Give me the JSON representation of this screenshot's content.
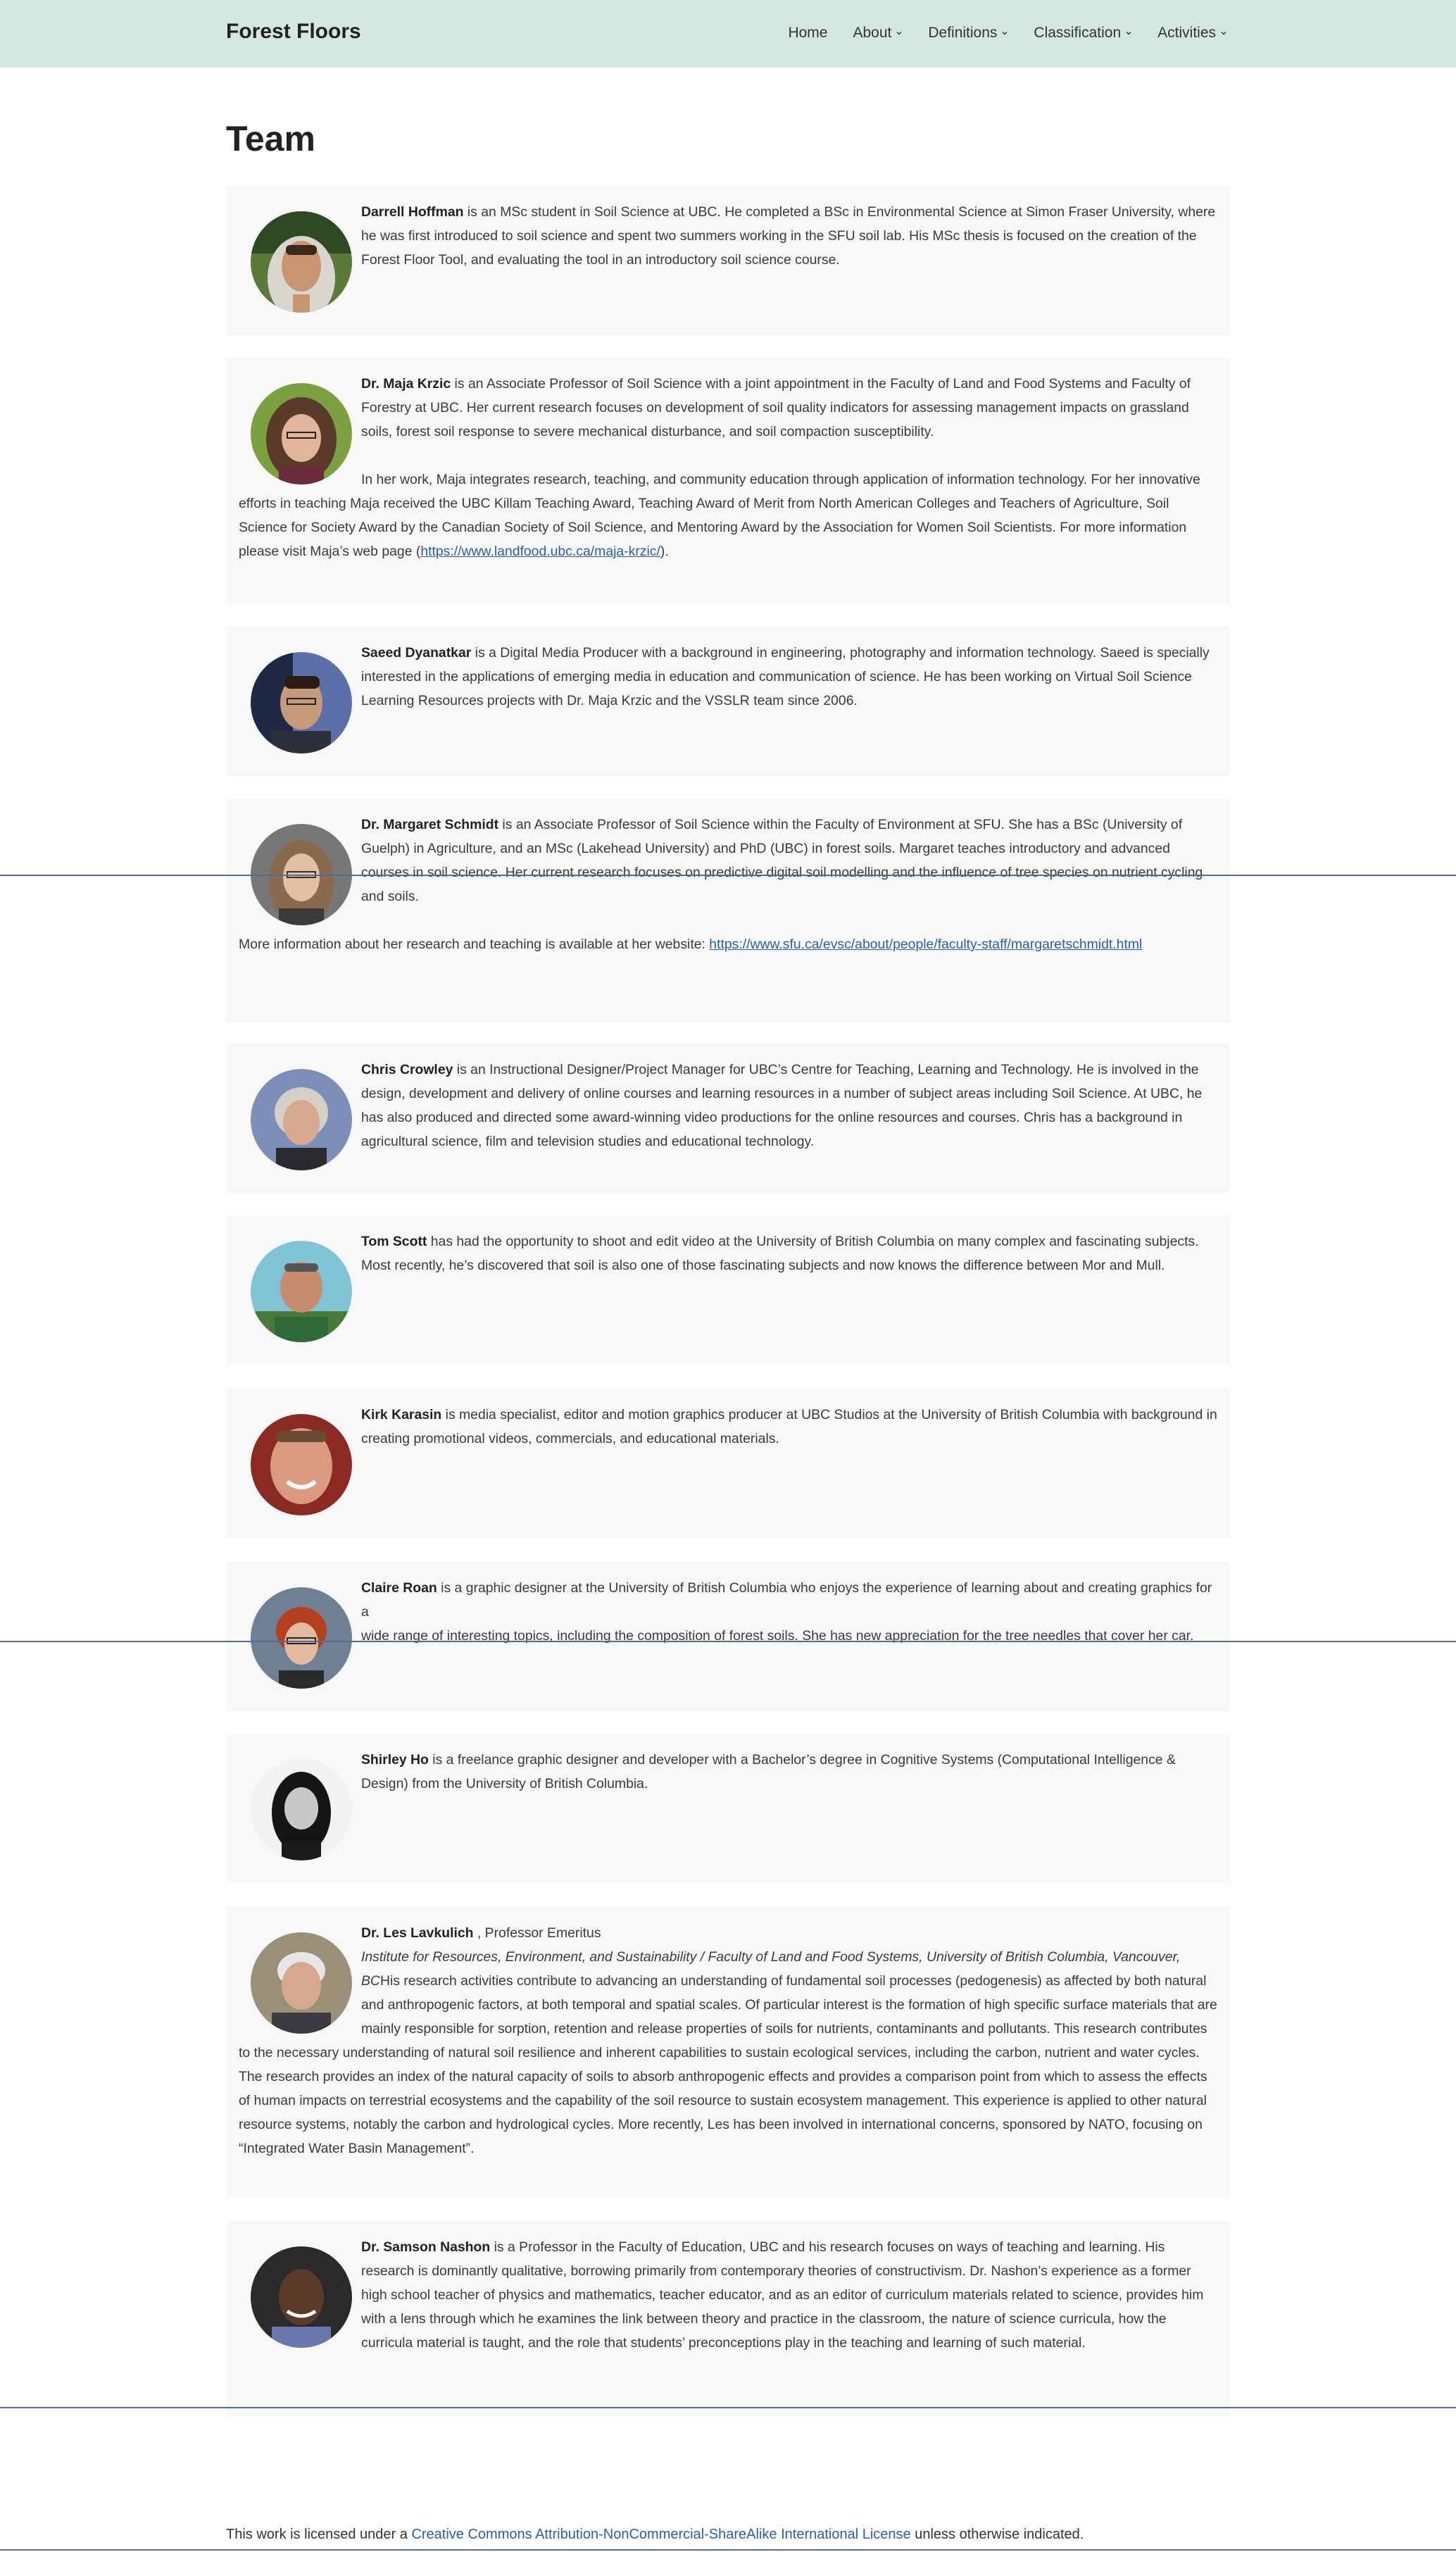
{
  "site": {
    "title": "Forest Floors"
  },
  "nav": [
    {
      "label": "Home",
      "dropdown": false
    },
    {
      "label": "About",
      "dropdown": true
    },
    {
      "label": "Definitions",
      "dropdown": true
    },
    {
      "label": "Classification",
      "dropdown": true
    },
    {
      "label": "Activities",
      "dropdown": true
    }
  ],
  "page": {
    "title": "Team"
  },
  "members": [
    {
      "name": "Darrell Hoffman",
      "bio": " is an MSc student in Soil Science at UBC. He completed a BSc in Environmental Science at Simon Fraser University, where he was first introduced to soil science and spent two summers working in the SFU soil lab. His MSc thesis is focused on the creation of the Forest Floor Tool, and evaluating the tool in an introductory soil science course.",
      "photo": "portrait-young-man-hoodie"
    },
    {
      "name": "Dr. Maja Krzic",
      "bio": " is an Associate Professor of Soil Science with a joint appointment in the Faculty of Land and Food Systems and Faculty of Forestry at UBC. Her current research focuses on development of soil quality indicators for assessing management impacts on grassland soils, forest soil response to severe mechanical disturbance, and soil compaction susceptibility.",
      "bio2": "In her work, Maja integrates research, teaching, and community education through application of information technology. For her innovative efforts in teaching Maja received the UBC Killam Teaching Award, Teaching Award of Merit from North American Colleges and Teachers of Agriculture, Soil Science for Society Award by the Canadian Society of Soil Science, and Mentoring Award by the Association for Women Soil Scientists. For more information please visit Maja’s web page (",
      "link": "https://www.landfood.ubc.ca/maja-krzic/",
      "bio2_end": ").",
      "photo": "portrait-woman-glasses"
    },
    {
      "name": "Saeed Dyanatkar",
      "bio": " is a Digital Media Producer with a background in engineering, photography and information technology. Saeed is specially interested in the applications of emerging media in education and communication of science. He has been working on Virtual Soil Science Learning Resources projects with Dr. Maja Krzic and the VSSLR team since 2006.",
      "photo": "portrait-man-glasses"
    },
    {
      "name": "Dr. Margaret Schmidt",
      "bio": " is an Associate Professor of Soil Science within the Faculty of Environment at SFU. She has a BSc (University of Guelph) in Agriculture, and an MSc (Lakehead University) and PhD (UBC) in forest soils. Margaret teaches introductory and advanced courses in soil science. Her current research focuses on predictive digital soil modelling and the influence of tree species on nutrient cycling and soils.",
      "bio2": "More information about her research and teaching is available at her website: ",
      "link": "https://www.sfu.ca/evsc/about/people/faculty-staff/margaretschmidt.html",
      "bio2_end": "",
      "photo": "portrait-woman-long-hair"
    },
    {
      "name": "Chris Crowley",
      "bio": " is an Instructional Designer/Project Manager for UBC’s Centre for Teaching, Learning and Technology. He is involved in the design, development and delivery of online courses and learning resources in a number of subject areas including Soil Science. At UBC, he has also produced and directed some award-winning video productions for the online resources and courses. Chris has a background in agricultural science, film and television studies and educational technology.",
      "photo": "portrait-man-grey-hair"
    },
    {
      "name": "Tom Scott",
      "bio": " has had the opportunity to shoot and edit video at the University of British Columbia on many complex and fascinating subjects. Most recently, he’s discovered that soil is also one of those fascinating subjects and now knows the difference between Mor and Mull.",
      "photo": "portrait-man-outdoors"
    },
    {
      "name": "Kirk Karasin",
      "bio": " is media specialist, editor and motion graphics producer at UBC Studios at the University of British Columbia with background in creating promotional videos, commercials, and educational materials.",
      "photo": "portrait-man-smiling"
    },
    {
      "name": "Claire Roan",
      "bio": " is a graphic designer at the University of British Columbia who enjoys the experience of learning about and creating graphics for a",
      "bio_line2": "wide range of interesting topics, including the composition of forest soils. She has new appreciation for the tree needles that cover her car.",
      "photo": "portrait-woman-red-hair"
    },
    {
      "name": "Shirley Ho",
      "bio": " is a freelance graphic designer and developer with a Bachelor’s degree in Cognitive Systems (Computational Intelligence & Design) from the University of British Columbia.",
      "photo": "portrait-woman-bw"
    },
    {
      "name": "Dr. Les Lavkulich",
      "title": " , Professor Emeritus",
      "affiliation": "Institute for Resources, Environment, and Sustainability / Faculty of Land and Food Systems, University of British Columbia, Vancouver, BC",
      "bio": "His research activities contribute to advancing an understanding of fundamental soil processes (pedogenesis) as affected by both natural and anthropogenic factors, at both temporal and spatial scales. Of particular interest is the formation of high specific surface materials that are mainly responsible for sorption, retention and release properties of soils for nutrients, contaminants and pollutants. This research contributes to the necessary understanding of natural soil resilience and inherent capabilities to sustain ecological services, including the carbon, nutrient and water cycles. The research provides an index of the natural capacity of soils to absorb anthropogenic effects and provides a comparison point from which to assess the effects of human impacts on terrestrial ecosystems and the capability of the soil resource to sustain ecosystem management. This experience is applied to other natural resource systems, notably the carbon and hydrological cycles. More recently, Les has been involved in international concerns, sponsored by NATO, focusing on “Integrated Water Basin Management”.",
      "photo": "portrait-older-man"
    },
    {
      "name": "Dr. Samson Nashon",
      "bio": " is a Professor in the Faculty of Education, UBC and his research focuses on ways of teaching and learning. His research is dominantly qualitative, borrowing primarily from contemporary theories of constructivism. Dr. Nashon’s experience as a former high school teacher of physics and mathematics, teacher educator, and as an editor of curriculum materials related to science, provides him with a lens through which he examines the link between theory and practice in the classroom, the nature of science curricula, how the curricula material is taught, and the role that students’ preconceptions play in the teaching and learning of such material.",
      "photo": "portrait-man-smiling-dark"
    }
  ],
  "footer": {
    "prefix": "This work is licensed under a ",
    "license_link": "Creative Commons Attribution-NonCommercial-ShareAlike International License",
    "suffix": " unless otherwise indicated."
  },
  "colors": {
    "header_bg": "#d3e7df",
    "card_bg": "#f8f8f8",
    "link": "#2b5ea8",
    "rule": "#4e6f93"
  }
}
